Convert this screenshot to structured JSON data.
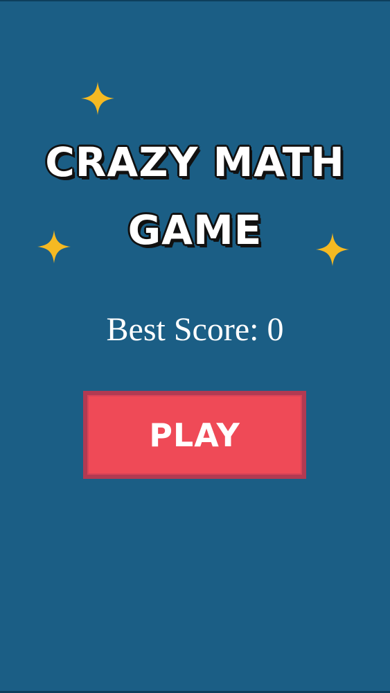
{
  "title": {
    "line1": "CRAZY MATH",
    "line2": "GAME"
  },
  "best_score": {
    "label": "Best Score: 0"
  },
  "play_button": {
    "label": "PLAY"
  },
  "colors": {
    "background": "#1b5e85",
    "star": "#f5b922",
    "play_button": "#ef4a57",
    "play_button_border": "#b23a52",
    "text": "#ffffff"
  },
  "icons": [
    "sparkle-star-icon"
  ]
}
